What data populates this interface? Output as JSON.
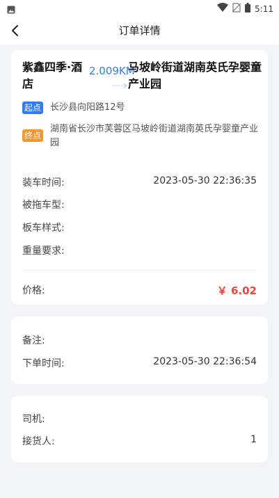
{
  "status_bar": {
    "time": "5:11",
    "icons": [
      "image-icon",
      "wifi-icon",
      "no-sim-icon",
      "battery-icon"
    ]
  },
  "header": {
    "title": "订单详情",
    "back_icon": "chevron-left-icon"
  },
  "route": {
    "from": "紫鑫四季·酒店",
    "distance": "2.009KM",
    "to": "马坡岭街道湖南英氏孕婴童产业园"
  },
  "addresses": {
    "start_tag": "起点",
    "start": "长沙县向阳路12号",
    "end_tag": "终点",
    "end": "湖南省长沙市芙蓉区马坡岭街道湖南英氏孕婴童产业园"
  },
  "details": {
    "load_time_label": "装车时间:",
    "load_time_value": "2023-05-30 22:36:35",
    "towed_type_label": "被拖车型:",
    "board_style_label": "板车样式:",
    "weight_label": "重量要求:",
    "price_label": "价格:",
    "price_value": "￥ 6.02"
  },
  "notes": {
    "remark_label": "备注:",
    "order_time_label": "下单时间:",
    "order_time_value": "2023-05-30 22:36:54"
  },
  "people": {
    "driver_label": "司机:",
    "receiver_label": "接货人:",
    "receiver_value": "1"
  },
  "colors": {
    "accent": "#2f7cf6",
    "start_tag": "#2f7cf6",
    "end_tag": "#f6962f",
    "price": "#f0443b",
    "background": "#f3f4f8"
  }
}
